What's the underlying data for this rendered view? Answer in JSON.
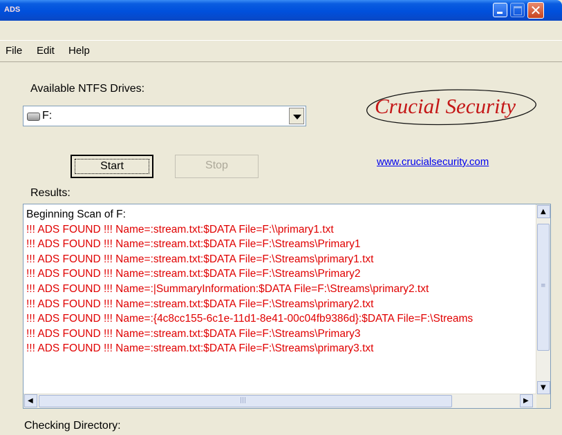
{
  "window": {
    "icon_label": "ADS",
    "colors": {
      "titlebar": "#0050dc",
      "face": "#ece9d8",
      "alert_text": "#e00000",
      "logo": "#c41717",
      "link": "#0000ee"
    }
  },
  "menu": {
    "file": "File",
    "edit": "Edit",
    "help": "Help"
  },
  "drives": {
    "label": "Available NTFS Drives:",
    "selected": "F:"
  },
  "buttons": {
    "start": "Start",
    "stop": "Stop"
  },
  "logo": {
    "text": "Crucial Security"
  },
  "link": {
    "text": "www.crucialsecurity.com"
  },
  "results": {
    "label": "Results:",
    "lines": [
      "Beginning Scan of F:",
      "!!! ADS FOUND !!! Name=:stream.txt:$DATA File=F:\\\\primary1.txt",
      "!!! ADS FOUND !!! Name=:stream.txt:$DATA File=F:\\Streams\\Primary1",
      "!!! ADS FOUND !!! Name=:stream.txt:$DATA File=F:\\Streams\\primary1.txt",
      "!!! ADS FOUND !!! Name=:stream.txt:$DATA File=F:\\Streams\\Primary2",
      "!!! ADS FOUND !!! Name=:|SummaryInformation:$DATA File=F:\\Streams\\primary2.txt",
      "!!! ADS FOUND !!! Name=:stream.txt:$DATA File=F:\\Streams\\primary2.txt",
      "!!! ADS FOUND !!! Name=:{4c8cc155-6c1e-11d1-8e41-00c04fb9386d}:$DATA File=F:\\Streams",
      "!!! ADS FOUND !!! Name=:stream.txt:$DATA File=F:\\Streams\\Primary3",
      "!!! ADS FOUND !!! Name=:stream.txt:$DATA File=F:\\Streams\\primary3.txt"
    ]
  },
  "status": {
    "label": "Checking Directory:"
  }
}
